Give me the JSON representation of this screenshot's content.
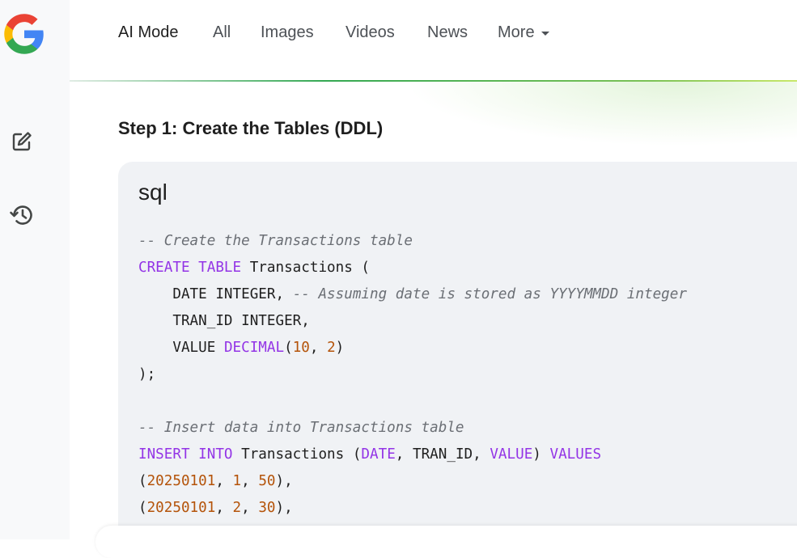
{
  "nav": {
    "tabs": [
      {
        "label": "AI Mode",
        "active": true
      },
      {
        "label": "All"
      },
      {
        "label": "Images"
      },
      {
        "label": "Videos"
      },
      {
        "label": "News"
      },
      {
        "label": "More"
      }
    ]
  },
  "sidebar": {
    "icons": [
      "google-logo",
      "new-chat-icon",
      "history-icon"
    ]
  },
  "content": {
    "step_title": "Step 1: Create the Tables (DDL)",
    "code_block": {
      "language": "sql",
      "lines": [
        "-- Create the Transactions table",
        "CREATE TABLE Transactions (",
        "    DATE INTEGER, -- Assuming date is stored as YYYYMMDD integer",
        "    TRAN_ID INTEGER,",
        "    VALUE DECIMAL(10, 2)",
        ");",
        "",
        "-- Insert data into Transactions table",
        "INSERT INTO Transactions (DATE, TRAN_ID, VALUE) VALUES",
        "(20250101, 1, 50),",
        "(20250101, 2, 30),"
      ]
    }
  },
  "colors": {
    "keyword": "#9334e6",
    "number": "#b45309",
    "comment": "#6b6f75",
    "code_bg": "#f0f2f5"
  }
}
